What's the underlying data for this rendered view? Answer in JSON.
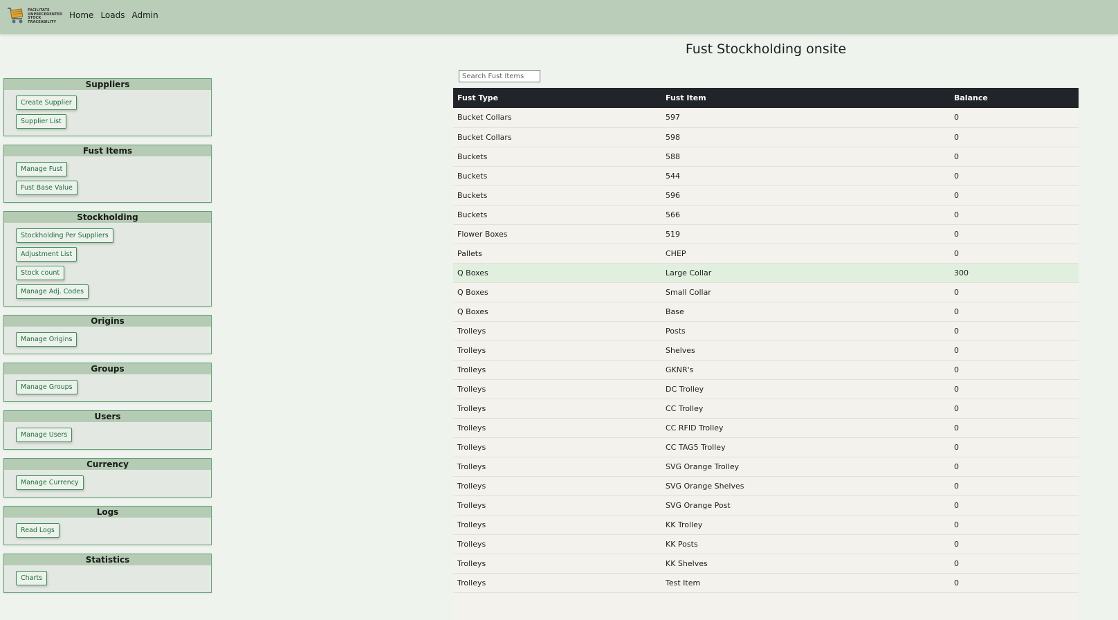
{
  "app": {
    "logo_text": [
      "FACILITATE",
      "UNPRECEDENTED",
      "STOCK",
      "TRACEABILITY"
    ],
    "nav": [
      {
        "label": "Home"
      },
      {
        "label": "Loads"
      },
      {
        "label": "Admin"
      }
    ]
  },
  "sidebar": {
    "sections": [
      {
        "title": "Suppliers",
        "buttons": [
          "Create Supplier",
          "Supplier List"
        ]
      },
      {
        "title": "Fust Items",
        "buttons": [
          "Manage Fust",
          "Fust Base Value"
        ]
      },
      {
        "title": "Stockholding",
        "buttons": [
          "Stockholding Per Suppliers",
          "Adjustment List",
          "Stock count",
          "Manage Adj. Codes"
        ]
      },
      {
        "title": "Origins",
        "buttons": [
          "Manage Origins"
        ]
      },
      {
        "title": "Groups",
        "buttons": [
          "Manage Groups"
        ]
      },
      {
        "title": "Users",
        "buttons": [
          "Manage Users"
        ]
      },
      {
        "title": "Currency",
        "buttons": [
          "Manage Currency"
        ]
      },
      {
        "title": "Logs",
        "buttons": [
          "Read Logs"
        ]
      },
      {
        "title": "Statistics",
        "buttons": [
          "Charts"
        ]
      }
    ]
  },
  "main": {
    "title": "Fust Stockholding onsite",
    "search_placeholder": "Search Fust Items",
    "table": {
      "headers": [
        "Fust Type",
        "Fust Item",
        "Balance"
      ],
      "rows": [
        [
          "Bucket Collars",
          "597",
          "0"
        ],
        [
          "Bucket Collars",
          "598",
          "0"
        ],
        [
          "Buckets",
          "588",
          "0"
        ],
        [
          "Buckets",
          "544",
          "0"
        ],
        [
          "Buckets",
          "596",
          "0"
        ],
        [
          "Buckets",
          "566",
          "0"
        ],
        [
          "Flower Boxes",
          "519",
          "0"
        ],
        [
          "Pallets",
          "CHEP",
          "0"
        ],
        [
          "Q Boxes",
          "Large Collar",
          "300"
        ],
        [
          "Q Boxes",
          "Small Collar",
          "0"
        ],
        [
          "Q Boxes",
          "Base",
          "0"
        ],
        [
          "Trolleys",
          "Posts",
          "0"
        ],
        [
          "Trolleys",
          "Shelves",
          "0"
        ],
        [
          "Trolleys",
          "GKNR's",
          "0"
        ],
        [
          "Trolleys",
          "DC Trolley",
          "0"
        ],
        [
          "Trolleys",
          "CC Trolley",
          "0"
        ],
        [
          "Trolleys",
          "CC RFID Trolley",
          "0"
        ],
        [
          "Trolleys",
          "CC TAG5 Trolley",
          "0"
        ],
        [
          "Trolleys",
          "SVG Orange Trolley",
          "0"
        ],
        [
          "Trolleys",
          "SVG Orange Shelves",
          "0"
        ],
        [
          "Trolleys",
          "SVG Orange Post",
          "0"
        ],
        [
          "Trolleys",
          "KK Trolley",
          "0"
        ],
        [
          "Trolleys",
          "KK Posts",
          "0"
        ],
        [
          "Trolleys",
          "KK Shelves",
          "0"
        ],
        [
          "Trolleys",
          "Test Item",
          "0"
        ]
      ],
      "highlighted_row_index": 8
    }
  },
  "colors": {
    "navbar": "#b9cdb9",
    "page_bg": "#eef3ee",
    "card_header": "#b6cbb4",
    "button_border": "#3f8d59",
    "table_header": "#212529",
    "highlight_row": "#e1efdf"
  }
}
